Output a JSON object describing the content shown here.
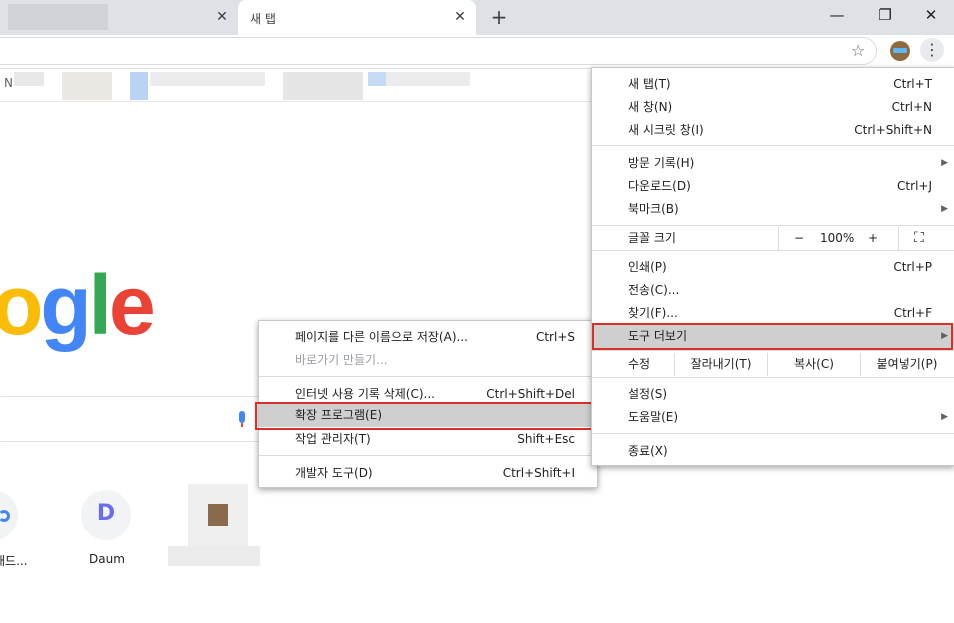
{
  "tabs": [
    {
      "title": "",
      "close": "✕"
    },
    {
      "title": "새 탭",
      "close": "✕"
    }
  ],
  "new_tab_glyph": "+",
  "window": {
    "minimize": "—",
    "restore": "❐",
    "close": "✕"
  },
  "toolbar": {
    "star": "☆",
    "menu": "⋮"
  },
  "bookmarks": {
    "first_char": "N"
  },
  "page": {
    "logo": [
      "o",
      "g",
      "l",
      "e"
    ],
    "logo_colors": [
      "#fbbc05",
      "#4285f4",
      "#34a853",
      "#ea4335"
    ],
    "shortcuts": [
      {
        "label": "패드..."
      },
      {
        "label": "Daum",
        "icon": "D"
      }
    ]
  },
  "chrome_menu": {
    "items_top": [
      {
        "label": "새 탭(T)",
        "acc": "Ctrl+T"
      },
      {
        "label": "새 창(N)",
        "acc": "Ctrl+N"
      },
      {
        "label": "새 시크릿 창(I)",
        "acc": "Ctrl+Shift+N"
      }
    ],
    "items_history": [
      {
        "label": "방문 기록(H)",
        "acc": ""
      },
      {
        "label": "다운로드(D)",
        "acc": "Ctrl+J"
      },
      {
        "label": "북마크(B)",
        "acc": ""
      }
    ],
    "zoom": {
      "label": "글꼴 크기",
      "minus": "−",
      "value": "100%",
      "plus": "+",
      "fullscreen": "⛶"
    },
    "items_print": [
      {
        "label": "인쇄(P)",
        "acc": "Ctrl+P"
      },
      {
        "label": "전송(C)...",
        "acc": ""
      },
      {
        "label": "찾기(F)...",
        "acc": "Ctrl+F"
      },
      {
        "label": "도구 더보기",
        "acc": ""
      }
    ],
    "edit": {
      "label": "수정",
      "cut": "잘라내기(T)",
      "copy": "복사(C)",
      "paste": "붙여넣기(P)"
    },
    "items_bottom": [
      {
        "label": "설정(S)",
        "acc": ""
      },
      {
        "label": "도움말(E)",
        "acc": ""
      }
    ],
    "exit": {
      "label": "종료(X)"
    }
  },
  "tools_submenu": {
    "items": [
      {
        "label": "페이지를 다른 이름으로 저장(A)...",
        "acc": "Ctrl+S"
      },
      {
        "label": "바로가기 만들기...",
        "acc": ""
      },
      {
        "label": "인터넷 사용 기록 삭제(C)...",
        "acc": "Ctrl+Shift+Del"
      },
      {
        "label": "확장 프로그램(E)",
        "acc": ""
      },
      {
        "label": "작업 관리자(T)",
        "acc": "Shift+Esc"
      },
      {
        "label": "개발자 도구(D)",
        "acc": "Ctrl+Shift+I"
      }
    ]
  },
  "arrow_glyph": "▶"
}
